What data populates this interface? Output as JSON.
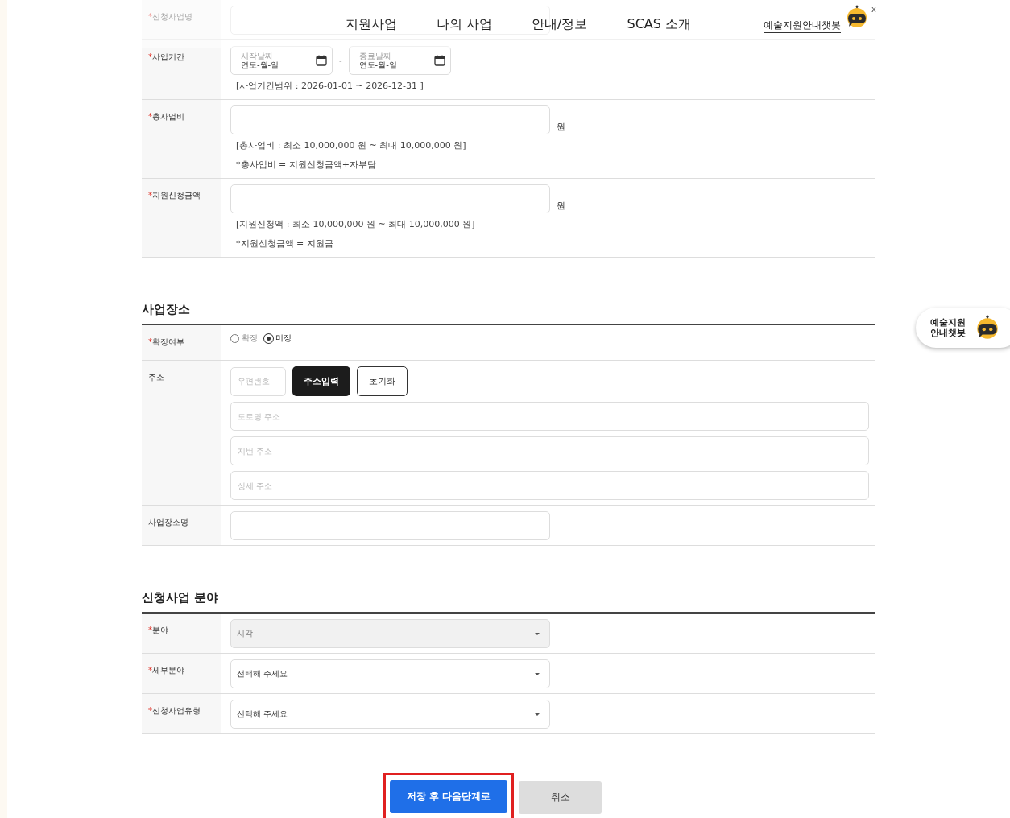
{
  "header": {
    "nav": [
      {
        "label": "지원사업"
      },
      {
        "label": "나의 사업"
      },
      {
        "label": "안내/정보"
      },
      {
        "label": "SCAS 소개"
      }
    ],
    "chatbot_link": "예술지원안내챗봇",
    "close": "x"
  },
  "sections": [
    {
      "rows": [
        {
          "kind": "text",
          "mark": "*",
          "label": "신청사업명"
        },
        {
          "kind": "date_range",
          "mark": "*",
          "label": "사업기간",
          "start": {
            "label": "시작날짜",
            "placeholder": "연도-월-일"
          },
          "separator": "-",
          "end": {
            "label": "종료날짜",
            "placeholder": "연도-월-일"
          },
          "notes": [
            "[사업기간범위 : 2026-01-01 ~ 2026-12-31 ]"
          ]
        },
        {
          "kind": "amount",
          "mark": "*",
          "label": "총사업비",
          "unit": "원",
          "notes": [
            "[총사업비 : 최소 10,000,000 원 ~ 최대 10,000,000 원]",
            "*총사업비 = 지원신청금액+자부담"
          ]
        },
        {
          "kind": "amount",
          "mark": "*",
          "label": "지원신청금액",
          "unit": "원",
          "notes": [
            "[지원신청액 : 최소 10,000,000 원 ~ 최대 10,000,000 원]",
            "*지원신청금액 = 지원금"
          ]
        }
      ]
    },
    {
      "title": "사업장소",
      "rows": [
        {
          "kind": "radio",
          "mark": "*",
          "label": "확정여부",
          "options": [
            {
              "label": "확정",
              "selected": false
            },
            {
              "label": "미정",
              "selected": true
            }
          ]
        },
        {
          "kind": "address",
          "label": "주소",
          "postcode": {
            "placeholder": "우편번호"
          },
          "buttons": [
            {
              "label": "주소입력",
              "primary": true
            },
            {
              "label": "초기화",
              "primary": false
            }
          ],
          "fields": [
            {
              "placeholder": "도로명 주소"
            },
            {
              "placeholder": "지번 주소"
            },
            {
              "placeholder": "상세 주소"
            }
          ]
        },
        {
          "kind": "text",
          "label": "사업장소명"
        }
      ]
    },
    {
      "title": "신청사업 분야",
      "rows": [
        {
          "kind": "select",
          "mark": "*",
          "label": "분야",
          "value": "시각",
          "disabled": true
        },
        {
          "kind": "select",
          "mark": "*",
          "label": "세부분야",
          "value": "선택해 주세요",
          "disabled": false
        },
        {
          "kind": "select",
          "mark": "*",
          "label": "신청사업유형",
          "value": "선택해 주세요",
          "disabled": false
        }
      ]
    }
  ],
  "actions": [
    {
      "label": "저장 후 다음단계로",
      "primary": true,
      "highlighted": true
    },
    {
      "label": "취소",
      "primary": false,
      "highlighted": false
    }
  ],
  "chatbot_widget": {
    "label": "예술지원\n안내챗봇"
  }
}
